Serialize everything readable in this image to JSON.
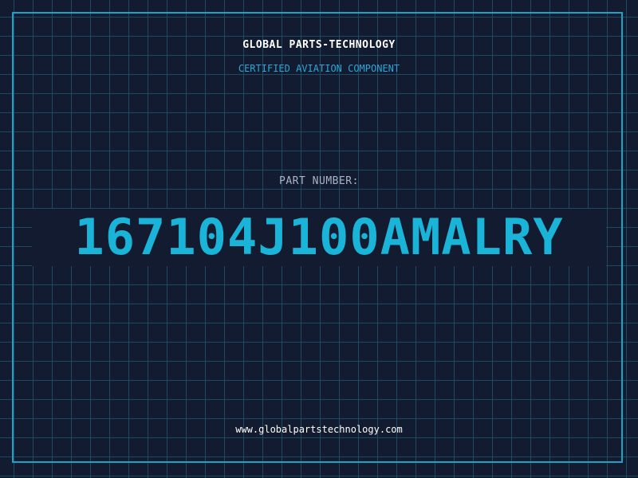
{
  "header": {
    "company": "GLOBAL PARTS-TECHNOLOGY",
    "subtitle": "CERTIFIED AVIATION COMPONENT"
  },
  "part": {
    "label": "PART NUMBER:",
    "number": "167104J100AMALRY"
  },
  "footer": {
    "website": "www.globalpartstechnology.com"
  },
  "colors": {
    "background": "#121b30",
    "grid": "#1e4a60",
    "accent": "#19b4d8",
    "border": "#1aa3c9"
  }
}
